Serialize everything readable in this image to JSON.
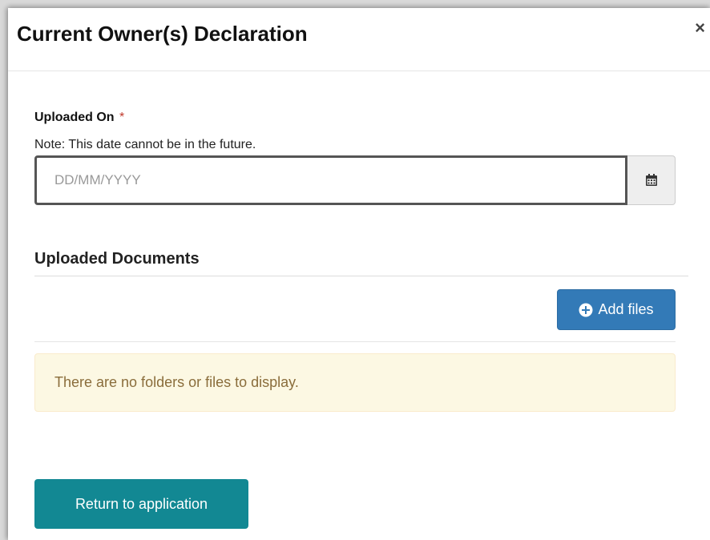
{
  "modal": {
    "title": "Current Owner(s) Declaration",
    "close_glyph": "×"
  },
  "uploaded_on": {
    "label": "Uploaded On",
    "required_mark": "*",
    "note": "Note: This date cannot be in the future.",
    "value": "",
    "placeholder": "DD/MM/YYYY",
    "icon": "calendar-icon"
  },
  "documents": {
    "section_title": "Uploaded Documents",
    "add_files_label": "Add files",
    "add_files_icon": "plus-circle-icon",
    "empty_message": "There are no folders or files to display."
  },
  "footer": {
    "return_label": "Return to application"
  },
  "colors": {
    "primary": "#337ab7",
    "teal": "#128893",
    "warning_bg": "#fcf8e3",
    "warning_text": "#8a6d3b",
    "required": "#c0392b"
  }
}
